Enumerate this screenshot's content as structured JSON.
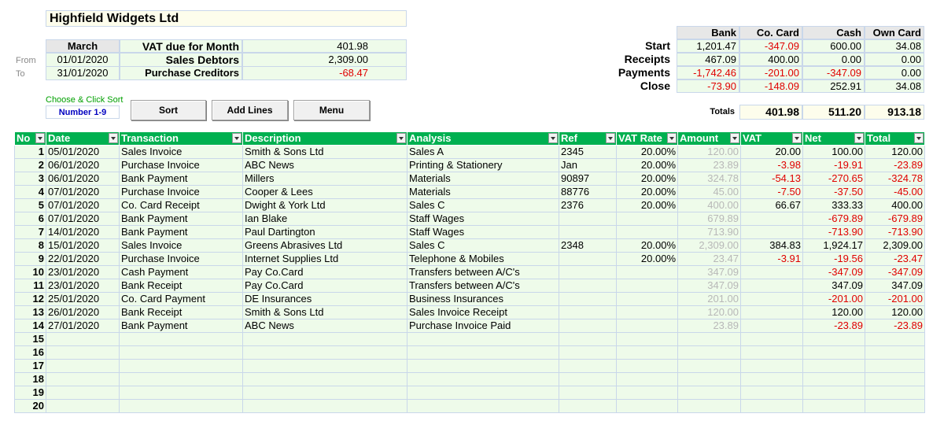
{
  "company_name": "Highfield Widgets Ltd",
  "summary": {
    "month": "March",
    "from_label": "From",
    "to_label": "To",
    "from_date": "01/01/2020",
    "to_date": "31/01/2020",
    "vat_label": "VAT due for Month",
    "vat_value": "401.98",
    "debtors_label": "Sales Debtors",
    "debtors_value": "2,309.00",
    "creditors_label": "Purchase Creditors",
    "creditors_value": "-68.47"
  },
  "sort": {
    "hint": "Choose & Click Sort",
    "selector": "Number  1-9",
    "sort_button": "Sort",
    "add_lines_button": "Add Lines",
    "menu_button": "Menu"
  },
  "balances": {
    "headers": [
      "Bank",
      "Co. Card",
      "Cash",
      "Own Card"
    ],
    "rows": [
      {
        "label": "Start",
        "values": [
          "1,201.47",
          "-347.09",
          "600.00",
          "34.08"
        ]
      },
      {
        "label": "Receipts",
        "values": [
          "467.09",
          "400.00",
          "0.00",
          "0.00"
        ]
      },
      {
        "label": "Payments",
        "values": [
          "-1,742.46",
          "-201.00",
          "-347.09",
          "0.00"
        ]
      },
      {
        "label": "Close",
        "values": [
          "-73.90",
          "-148.09",
          "252.91",
          "34.08"
        ]
      }
    ],
    "totals_label": "Totals",
    "totals": [
      "401.98",
      "511.20",
      "913.18"
    ]
  },
  "ledger": {
    "columns": [
      "No",
      "Date",
      "Transaction",
      "Description",
      "Analysis",
      "Ref",
      "VAT Rate",
      "Amount",
      "VAT",
      "Net",
      "Total"
    ],
    "rows": [
      [
        "1",
        "05/01/2020",
        "Sales Invoice",
        "Smith & Sons Ltd",
        "Sales A",
        "2345",
        "20.00%",
        "120.00",
        "20.00",
        "100.00",
        "120.00"
      ],
      [
        "2",
        "06/01/2020",
        "Purchase Invoice",
        "ABC News",
        "Printing & Stationery",
        "Jan",
        "20.00%",
        "23.89",
        "-3.98",
        "-19.91",
        "-23.89"
      ],
      [
        "3",
        "06/01/2020",
        "Bank Payment",
        "Millers",
        "Materials",
        "90897",
        "20.00%",
        "324.78",
        "-54.13",
        "-270.65",
        "-324.78"
      ],
      [
        "4",
        "07/01/2020",
        "Purchase Invoice",
        "Cooper & Lees",
        "Materials",
        "88776",
        "20.00%",
        "45.00",
        "-7.50",
        "-37.50",
        "-45.00"
      ],
      [
        "5",
        "07/01/2020",
        "Co. Card Receipt",
        "Dwight & York Ltd",
        "Sales C",
        "2376",
        "20.00%",
        "400.00",
        "66.67",
        "333.33",
        "400.00"
      ],
      [
        "6",
        "07/01/2020",
        "Bank Payment",
        "Ian Blake",
        "Staff Wages",
        "",
        "",
        "679.89",
        "",
        "-679.89",
        "-679.89"
      ],
      [
        "7",
        "14/01/2020",
        "Bank Payment",
        "Paul Dartington",
        "Staff Wages",
        "",
        "",
        "713.90",
        "",
        "-713.90",
        "-713.90"
      ],
      [
        "8",
        "15/01/2020",
        "Sales Invoice",
        "Greens Abrasives Ltd",
        "Sales C",
        "2348",
        "20.00%",
        "2,309.00",
        "384.83",
        "1,924.17",
        "2,309.00"
      ],
      [
        "9",
        "22/01/2020",
        "Purchase Invoice",
        "Internet Supplies Ltd",
        "Telephone & Mobiles",
        "",
        "20.00%",
        "23.47",
        "-3.91",
        "-19.56",
        "-23.47"
      ],
      [
        "10",
        "23/01/2020",
        "Cash Payment",
        "Pay Co.Card",
        "Transfers between A/C's",
        "",
        "",
        "347.09",
        "",
        "-347.09",
        "-347.09"
      ],
      [
        "11",
        "23/01/2020",
        "Bank Receipt",
        "Pay Co.Card",
        "Transfers between A/C's",
        "",
        "",
        "347.09",
        "",
        "347.09",
        "347.09"
      ],
      [
        "12",
        "25/01/2020",
        "Co. Card Payment",
        "DE Insurances",
        "Business Insurances",
        "",
        "",
        "201.00",
        "",
        "-201.00",
        "-201.00"
      ],
      [
        "13",
        "26/01/2020",
        "Bank Receipt",
        "Smith & Sons Ltd",
        "Sales Invoice Receipt",
        "",
        "",
        "120.00",
        "",
        "120.00",
        "120.00"
      ],
      [
        "14",
        "27/01/2020",
        "Bank Payment",
        "ABC News",
        "Purchase Invoice Paid",
        "",
        "",
        "23.89",
        "",
        "-23.89",
        "-23.89"
      ],
      [
        "15",
        "",
        "",
        "",
        "",
        "",
        "",
        "",
        "",
        "",
        ""
      ],
      [
        "16",
        "",
        "",
        "",
        "",
        "",
        "",
        "",
        "",
        "",
        ""
      ],
      [
        "17",
        "",
        "",
        "",
        "",
        "",
        "",
        "",
        "",
        "",
        ""
      ],
      [
        "18",
        "",
        "",
        "",
        "",
        "",
        "",
        "",
        "",
        "",
        ""
      ],
      [
        "19",
        "",
        "",
        "",
        "",
        "",
        "",
        "",
        "",
        "",
        ""
      ],
      [
        "20",
        "",
        "",
        "",
        "",
        "",
        "",
        "",
        "",
        "",
        ""
      ]
    ]
  },
  "colors": {
    "header_green": "#00b050",
    "cell_fill": "#eefbea",
    "negative": "#e00000",
    "amount_grey": "#b8b8b8"
  }
}
